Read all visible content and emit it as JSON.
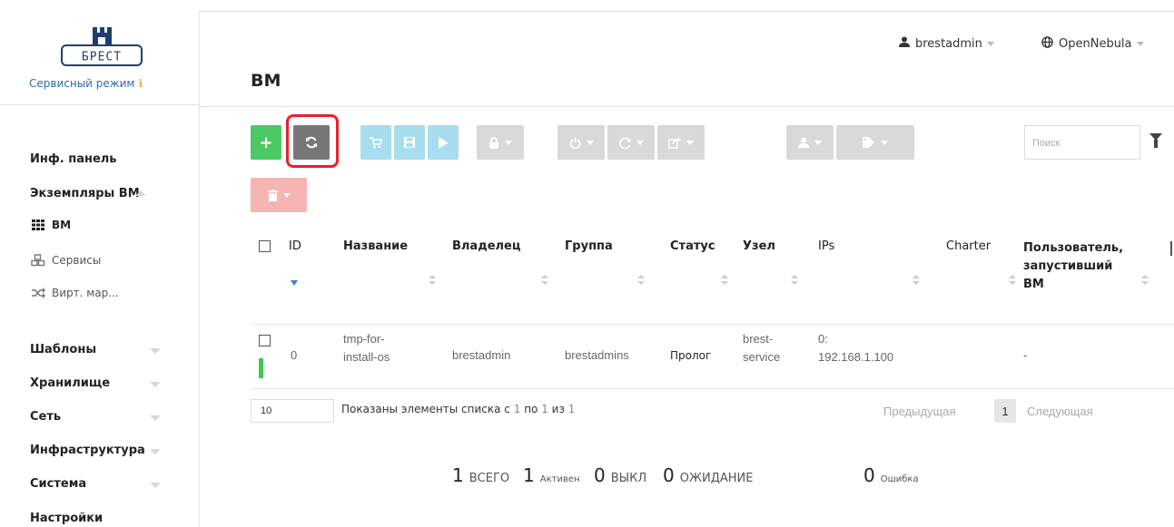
{
  "brand": {
    "mode_label": "Сервисный режим",
    "logo_text": "БРЕСТ"
  },
  "sidebar": {
    "dashboard": "Инф. панель",
    "instances": "Экземпляры ВМ",
    "vms": "ВМ",
    "services": "Сервисы",
    "vrouters": "Вирт. мар...",
    "templates": "Шаблоны",
    "storage": "Хранилище",
    "network": "Сеть",
    "infrastructure": "Инфраструктура",
    "system": "Система",
    "settings": "Настройки"
  },
  "header": {
    "title": "ВМ",
    "user": "brestadmin",
    "zone": "OpenNebula"
  },
  "toolbar": {
    "add": "+",
    "search_placeholder": "Поиск"
  },
  "table": {
    "headers": {
      "id": "ID",
      "name": "Название",
      "owner": "Владелец",
      "group": "Группа",
      "status": "Статус",
      "host": "Узел",
      "ips": "IPs",
      "charter": "Charter",
      "launched_by_1": "Пользователь,",
      "launched_by_2": "запустивший",
      "launched_by_3": "ВМ"
    },
    "rows": [
      {
        "id": "0",
        "name_1": "tmp-for-",
        "name_2": "install-os",
        "owner": "brestadmin",
        "group": "brestadmins",
        "status": "Пролог",
        "host_1": "brest-",
        "host_2": "service",
        "ips_1": "0:",
        "ips_2": "192.168.1.100",
        "launched_by": "-"
      }
    ]
  },
  "footer": {
    "page_size": "10",
    "showing_prefix": "Показаны элементы списка с",
    "showing_from": "1",
    "showing_mid1": "по",
    "showing_to": "1",
    "showing_mid2": "из",
    "showing_total": "1",
    "prev": "Предыдущая",
    "current_page": "1",
    "next": "Следующая"
  },
  "summary": {
    "total_n": "1",
    "total_l": "ВСЕГО",
    "active_n": "1",
    "active_l": "Активен",
    "off_n": "0",
    "off_l": "ВЫКЛ",
    "pending_n": "0",
    "pending_l": "ОЖИДАНИЕ",
    "error_n": "0",
    "error_l": "Ошибка"
  },
  "colors": {
    "accent_green": "#4cc964",
    "highlight_red": "#e8202a",
    "running_green": "#3ec954"
  }
}
